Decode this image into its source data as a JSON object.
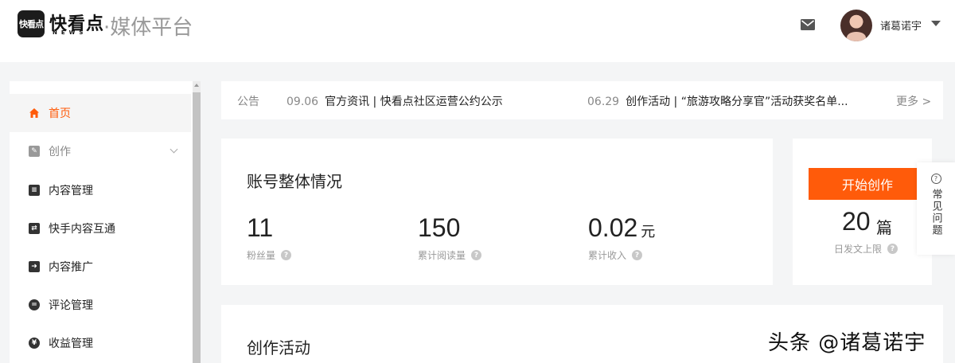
{
  "header": {
    "logo_mark": "快看点",
    "logo_text": "快看点",
    "logo_sub": "NEWS",
    "logo_tail": "·媒体平台",
    "icons": {
      "mail": "mail-icon",
      "dropdown": "caret-down-icon"
    },
    "username": "诸葛诺宇"
  },
  "sidebar": {
    "items": [
      {
        "label": "首页",
        "icon": "home-icon",
        "active": true
      },
      {
        "label": "创作",
        "icon": "edit-icon",
        "muted": true,
        "expandable": true
      },
      {
        "label": "内容管理",
        "icon": "document-icon"
      },
      {
        "label": "快手内容互通",
        "icon": "share-icon"
      },
      {
        "label": "内容推广",
        "icon": "promote-icon"
      },
      {
        "label": "评论管理",
        "icon": "comment-icon"
      },
      {
        "label": "收益管理",
        "icon": "yen-icon"
      }
    ]
  },
  "announcement": {
    "label": "公告",
    "items": [
      {
        "date": "09.06",
        "text": "官方资讯 | 快看点社区运营公约公示"
      },
      {
        "date": "06.29",
        "text": "创作活动 | “旅游攻略分享官”活动获奖名单..."
      }
    ],
    "more": "更多 >"
  },
  "account": {
    "title": "账号整体情况",
    "stats": [
      {
        "value": "11",
        "unit": "",
        "label": "粉丝量"
      },
      {
        "value": "150",
        "unit": "",
        "label": "累计阅读量"
      },
      {
        "value": "0.02",
        "unit": "元",
        "label": "累计收入"
      }
    ]
  },
  "create": {
    "button": "开始创作",
    "limit_value": "20",
    "limit_unit": "篇",
    "limit_label": "日发文上限"
  },
  "faq": {
    "label": "常见问题",
    "icon": "question-circle-icon"
  },
  "activity": {
    "title": "创作活动"
  },
  "watermark": "头条 @诸葛诺宇",
  "colors": {
    "accent": "#ff5b0a",
    "background": "#f4f5f6",
    "text": "#222222",
    "muted": "#999999"
  }
}
